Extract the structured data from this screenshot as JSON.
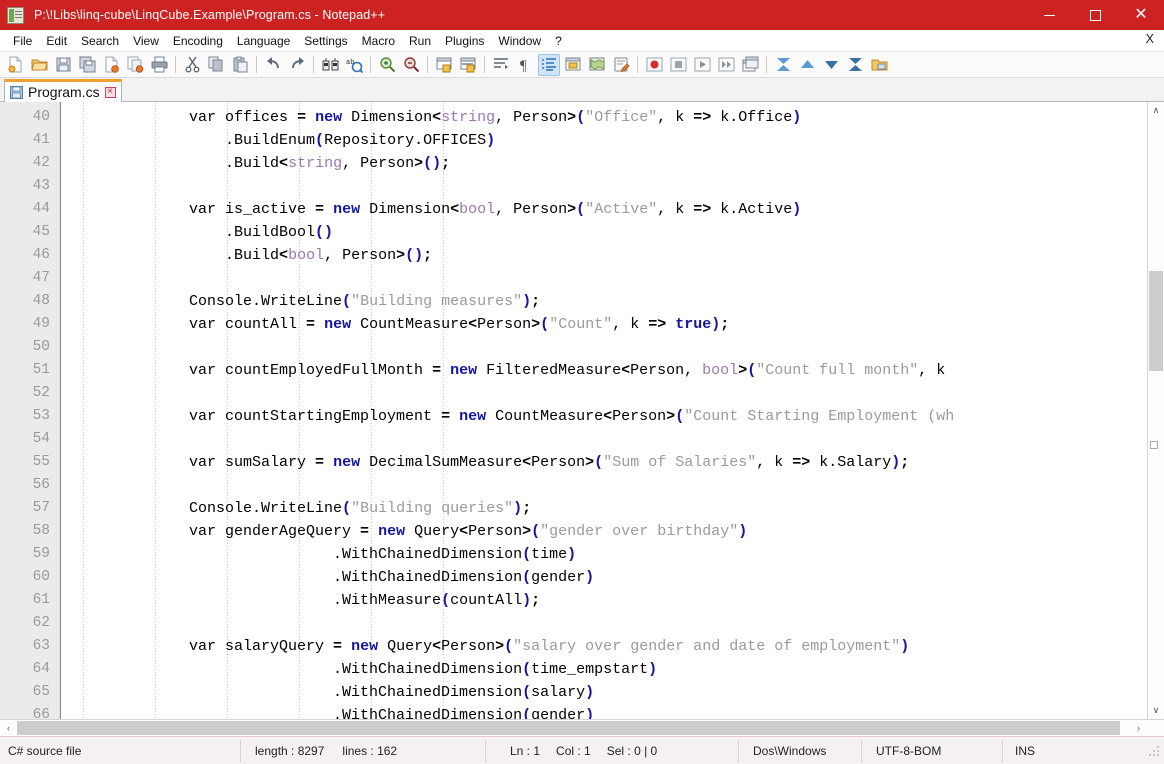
{
  "window": {
    "title": "P:\\!Libs\\linq-cube\\LinqCube.Example\\Program.cs - Notepad++",
    "app_icon": "notepad-plus-plus-icon",
    "titlebar_color": "#cc2222",
    "minimize_label": "—",
    "maximize_label": "□",
    "close_label": "×"
  },
  "menubar": {
    "items": [
      {
        "label": "File"
      },
      {
        "label": "Edit"
      },
      {
        "label": "Search"
      },
      {
        "label": "View"
      },
      {
        "label": "Encoding"
      },
      {
        "label": "Language"
      },
      {
        "label": "Settings"
      },
      {
        "label": "Macro"
      },
      {
        "label": "Run"
      },
      {
        "label": "Plugins"
      },
      {
        "label": "Window"
      },
      {
        "label": "?"
      }
    ],
    "close_doc_label": "X"
  },
  "toolbar": {
    "buttons": [
      {
        "name": "new-file-icon"
      },
      {
        "name": "open-file-icon"
      },
      {
        "name": "save-icon"
      },
      {
        "name": "save-all-icon"
      },
      {
        "name": "close-file-icon"
      },
      {
        "name": "close-all-icon"
      },
      {
        "name": "print-icon"
      },
      {
        "sep": true
      },
      {
        "name": "cut-icon"
      },
      {
        "name": "copy-icon"
      },
      {
        "name": "paste-icon"
      },
      {
        "sep": true
      },
      {
        "name": "undo-icon"
      },
      {
        "name": "redo-icon"
      },
      {
        "sep": true
      },
      {
        "name": "find-icon"
      },
      {
        "name": "replace-icon"
      },
      {
        "sep": true
      },
      {
        "name": "zoom-in-icon"
      },
      {
        "name": "zoom-out-icon"
      },
      {
        "sep": true
      },
      {
        "name": "sync-vertical-scroll-icon"
      },
      {
        "name": "sync-horizontal-scroll-icon"
      },
      {
        "sep": true
      },
      {
        "name": "word-wrap-icon"
      },
      {
        "name": "show-all-chars-icon"
      },
      {
        "name": "indent-guide-icon",
        "active": true
      },
      {
        "name": "user-defined-dialog-icon"
      },
      {
        "name": "document-map-icon"
      },
      {
        "name": "function-list-icon"
      },
      {
        "sep": true
      },
      {
        "name": "record-macro-icon"
      },
      {
        "name": "stop-macro-icon"
      },
      {
        "name": "play-macro-icon"
      },
      {
        "name": "run-macro-multiple-icon"
      },
      {
        "name": "save-macro-icon"
      },
      {
        "sep": true
      },
      {
        "name": "collapse-all-icon"
      },
      {
        "name": "fold-up-icon"
      },
      {
        "name": "unfold-down-icon"
      },
      {
        "name": "expand-all-icon"
      },
      {
        "name": "folder-as-workspace-icon"
      }
    ]
  },
  "tabs": [
    {
      "label": "Program.cs",
      "active": true,
      "icon": "saved-file-icon",
      "close_label": "×"
    }
  ],
  "editor": {
    "first_line_number": 40,
    "lines": [
      {
        "num": 40,
        "tokens": [
          {
            "t": "            ",
            "c": "pl"
          },
          {
            "t": "var offices ",
            "c": "pl"
          },
          {
            "t": "=",
            "c": "op"
          },
          {
            "t": " ",
            "c": "pl"
          },
          {
            "t": "new",
            "c": "kw"
          },
          {
            "t": " Dimension",
            "c": "pl"
          },
          {
            "t": "<",
            "c": "op"
          },
          {
            "t": "string",
            "c": "type"
          },
          {
            "t": ", Person",
            "c": "pl"
          },
          {
            "t": ">",
            "c": "op"
          },
          {
            "t": "(",
            "c": "br"
          },
          {
            "t": "\"Office\"",
            "c": "str"
          },
          {
            "t": ", k ",
            "c": "pl"
          },
          {
            "t": "=>",
            "c": "op"
          },
          {
            "t": " k.Office",
            "c": "pl"
          },
          {
            "t": ")",
            "c": "br"
          }
        ]
      },
      {
        "num": 41,
        "tokens": [
          {
            "t": "                .BuildEnum",
            "c": "pl"
          },
          {
            "t": "(",
            "c": "br"
          },
          {
            "t": "Repository.OFFICES",
            "c": "pl"
          },
          {
            "t": ")",
            "c": "br"
          }
        ]
      },
      {
        "num": 42,
        "tokens": [
          {
            "t": "                .Build",
            "c": "pl"
          },
          {
            "t": "<",
            "c": "op"
          },
          {
            "t": "string",
            "c": "type"
          },
          {
            "t": ", Person",
            "c": "pl"
          },
          {
            "t": ">",
            "c": "op"
          },
          {
            "t": "()",
            "c": "br"
          },
          {
            "t": ";",
            "c": "op"
          }
        ]
      },
      {
        "num": 43,
        "tokens": []
      },
      {
        "num": 44,
        "tokens": [
          {
            "t": "            var is_active ",
            "c": "pl"
          },
          {
            "t": "=",
            "c": "op"
          },
          {
            "t": " ",
            "c": "pl"
          },
          {
            "t": "new",
            "c": "kw"
          },
          {
            "t": " Dimension",
            "c": "pl"
          },
          {
            "t": "<",
            "c": "op"
          },
          {
            "t": "bool",
            "c": "type"
          },
          {
            "t": ", Person",
            "c": "pl"
          },
          {
            "t": ">",
            "c": "op"
          },
          {
            "t": "(",
            "c": "br"
          },
          {
            "t": "\"Active\"",
            "c": "str"
          },
          {
            "t": ", k ",
            "c": "pl"
          },
          {
            "t": "=>",
            "c": "op"
          },
          {
            "t": " k.Active",
            "c": "pl"
          },
          {
            "t": ")",
            "c": "br"
          }
        ]
      },
      {
        "num": 45,
        "tokens": [
          {
            "t": "                .BuildBool",
            "c": "pl"
          },
          {
            "t": "()",
            "c": "br"
          }
        ]
      },
      {
        "num": 46,
        "tokens": [
          {
            "t": "                .Build",
            "c": "pl"
          },
          {
            "t": "<",
            "c": "op"
          },
          {
            "t": "bool",
            "c": "type"
          },
          {
            "t": ", Person",
            "c": "pl"
          },
          {
            "t": ">",
            "c": "op"
          },
          {
            "t": "()",
            "c": "br"
          },
          {
            "t": ";",
            "c": "op"
          }
        ]
      },
      {
        "num": 47,
        "tokens": []
      },
      {
        "num": 48,
        "tokens": [
          {
            "t": "            Console.WriteLine",
            "c": "pl"
          },
          {
            "t": "(",
            "c": "br"
          },
          {
            "t": "\"Building measures\"",
            "c": "str"
          },
          {
            "t": ")",
            "c": "br"
          },
          {
            "t": ";",
            "c": "op"
          }
        ]
      },
      {
        "num": 49,
        "tokens": [
          {
            "t": "            var countAll ",
            "c": "pl"
          },
          {
            "t": "=",
            "c": "op"
          },
          {
            "t": " ",
            "c": "pl"
          },
          {
            "t": "new",
            "c": "kw"
          },
          {
            "t": " CountMeasure",
            "c": "pl"
          },
          {
            "t": "<",
            "c": "op"
          },
          {
            "t": "Person",
            "c": "pl"
          },
          {
            "t": ">",
            "c": "op"
          },
          {
            "t": "(",
            "c": "br"
          },
          {
            "t": "\"Count\"",
            "c": "str"
          },
          {
            "t": ", k ",
            "c": "pl"
          },
          {
            "t": "=>",
            "c": "op"
          },
          {
            "t": " ",
            "c": "pl"
          },
          {
            "t": "true",
            "c": "kw"
          },
          {
            "t": ")",
            "c": "br"
          },
          {
            "t": ";",
            "c": "op"
          }
        ]
      },
      {
        "num": 50,
        "tokens": []
      },
      {
        "num": 51,
        "tokens": [
          {
            "t": "            var countEmployedFullMonth ",
            "c": "pl"
          },
          {
            "t": "=",
            "c": "op"
          },
          {
            "t": " ",
            "c": "pl"
          },
          {
            "t": "new",
            "c": "kw"
          },
          {
            "t": " FilteredMeasure",
            "c": "pl"
          },
          {
            "t": "<",
            "c": "op"
          },
          {
            "t": "Person, ",
            "c": "pl"
          },
          {
            "t": "bool",
            "c": "type"
          },
          {
            "t": ">",
            "c": "op"
          },
          {
            "t": "(",
            "c": "br"
          },
          {
            "t": "\"Count full month\"",
            "c": "str"
          },
          {
            "t": ", k",
            "c": "pl"
          }
        ]
      },
      {
        "num": 52,
        "tokens": []
      },
      {
        "num": 53,
        "tokens": [
          {
            "t": "            var countStartingEmployment ",
            "c": "pl"
          },
          {
            "t": "=",
            "c": "op"
          },
          {
            "t": " ",
            "c": "pl"
          },
          {
            "t": "new",
            "c": "kw"
          },
          {
            "t": " CountMeasure",
            "c": "pl"
          },
          {
            "t": "<",
            "c": "op"
          },
          {
            "t": "Person",
            "c": "pl"
          },
          {
            "t": ">",
            "c": "op"
          },
          {
            "t": "(",
            "c": "br"
          },
          {
            "t": "\"Count Starting Employment (wh",
            "c": "str"
          }
        ]
      },
      {
        "num": 54,
        "tokens": []
      },
      {
        "num": 55,
        "tokens": [
          {
            "t": "            var sumSalary ",
            "c": "pl"
          },
          {
            "t": "=",
            "c": "op"
          },
          {
            "t": " ",
            "c": "pl"
          },
          {
            "t": "new",
            "c": "kw"
          },
          {
            "t": " DecimalSumMeasure",
            "c": "pl"
          },
          {
            "t": "<",
            "c": "op"
          },
          {
            "t": "Person",
            "c": "pl"
          },
          {
            "t": ">",
            "c": "op"
          },
          {
            "t": "(",
            "c": "br"
          },
          {
            "t": "\"Sum of Salaries\"",
            "c": "str"
          },
          {
            "t": ", k ",
            "c": "pl"
          },
          {
            "t": "=>",
            "c": "op"
          },
          {
            "t": " k.Salary",
            "c": "pl"
          },
          {
            "t": ")",
            "c": "br"
          },
          {
            "t": ";",
            "c": "op"
          }
        ]
      },
      {
        "num": 56,
        "tokens": []
      },
      {
        "num": 57,
        "tokens": [
          {
            "t": "            Console.WriteLine",
            "c": "pl"
          },
          {
            "t": "(",
            "c": "br"
          },
          {
            "t": "\"Building queries\"",
            "c": "str"
          },
          {
            "t": ")",
            "c": "br"
          },
          {
            "t": ";",
            "c": "op"
          }
        ]
      },
      {
        "num": 58,
        "tokens": [
          {
            "t": "            var genderAgeQuery ",
            "c": "pl"
          },
          {
            "t": "=",
            "c": "op"
          },
          {
            "t": " ",
            "c": "pl"
          },
          {
            "t": "new",
            "c": "kw"
          },
          {
            "t": " Query",
            "c": "pl"
          },
          {
            "t": "<",
            "c": "op"
          },
          {
            "t": "Person",
            "c": "pl"
          },
          {
            "t": ">",
            "c": "op"
          },
          {
            "t": "(",
            "c": "br"
          },
          {
            "t": "\"gender over birthday\"",
            "c": "str"
          },
          {
            "t": ")",
            "c": "br"
          }
        ]
      },
      {
        "num": 59,
        "tokens": [
          {
            "t": "                            .WithChainedDimension",
            "c": "pl"
          },
          {
            "t": "(",
            "c": "br"
          },
          {
            "t": "time",
            "c": "pl"
          },
          {
            "t": ")",
            "c": "br"
          }
        ]
      },
      {
        "num": 60,
        "tokens": [
          {
            "t": "                            .WithChainedDimension",
            "c": "pl"
          },
          {
            "t": "(",
            "c": "br"
          },
          {
            "t": "gender",
            "c": "pl"
          },
          {
            "t": ")",
            "c": "br"
          }
        ]
      },
      {
        "num": 61,
        "tokens": [
          {
            "t": "                            .WithMeasure",
            "c": "pl"
          },
          {
            "t": "(",
            "c": "br"
          },
          {
            "t": "countAll",
            "c": "pl"
          },
          {
            "t": ")",
            "c": "br"
          },
          {
            "t": ";",
            "c": "op"
          }
        ]
      },
      {
        "num": 62,
        "tokens": []
      },
      {
        "num": 63,
        "tokens": [
          {
            "t": "            var salaryQuery ",
            "c": "pl"
          },
          {
            "t": "=",
            "c": "op"
          },
          {
            "t": " ",
            "c": "pl"
          },
          {
            "t": "new",
            "c": "kw"
          },
          {
            "t": " Query",
            "c": "pl"
          },
          {
            "t": "<",
            "c": "op"
          },
          {
            "t": "Person",
            "c": "pl"
          },
          {
            "t": ">",
            "c": "op"
          },
          {
            "t": "(",
            "c": "br"
          },
          {
            "t": "\"salary over gender and date of employment\"",
            "c": "str"
          },
          {
            "t": ")",
            "c": "br"
          }
        ]
      },
      {
        "num": 64,
        "tokens": [
          {
            "t": "                            .WithChainedDimension",
            "c": "pl"
          },
          {
            "t": "(",
            "c": "br"
          },
          {
            "t": "time_empstart",
            "c": "pl"
          },
          {
            "t": ")",
            "c": "br"
          }
        ]
      },
      {
        "num": 65,
        "tokens": [
          {
            "t": "                            .WithChainedDimension",
            "c": "pl"
          },
          {
            "t": "(",
            "c": "br"
          },
          {
            "t": "salary",
            "c": "pl"
          },
          {
            "t": ")",
            "c": "br"
          }
        ]
      },
      {
        "num": 66,
        "tokens": [
          {
            "t": "                            .WithChainedDimension",
            "c": "pl"
          },
          {
            "t": "(",
            "c": "br"
          },
          {
            "t": "gender",
            "c": "pl"
          },
          {
            "t": ")",
            "c": "br"
          }
        ]
      }
    ],
    "colors": {
      "keyword": "#1414a0",
      "type": "#9a77b0",
      "string": "#9a9a9a",
      "plain": "#000000",
      "line_number": "#9a9a9a",
      "gutter_bg": "#ebebeb",
      "background": "#ffffff"
    }
  },
  "scrollbars": {
    "vertical": {
      "up_arrow": "∧",
      "down_arrow": "∨"
    },
    "horizontal": {
      "left_arrow": "‹",
      "right_arrow": "›"
    }
  },
  "statusbar": {
    "doc_type": "C# source file",
    "length_label": "length : 8297",
    "lines_label": "lines : 162",
    "ln": "Ln : 1",
    "col": "Col : 1",
    "sel": "Sel : 0 | 0",
    "eol": "Dos\\Windows",
    "encoding": "UTF-8-BOM",
    "insert_mode": "INS"
  }
}
